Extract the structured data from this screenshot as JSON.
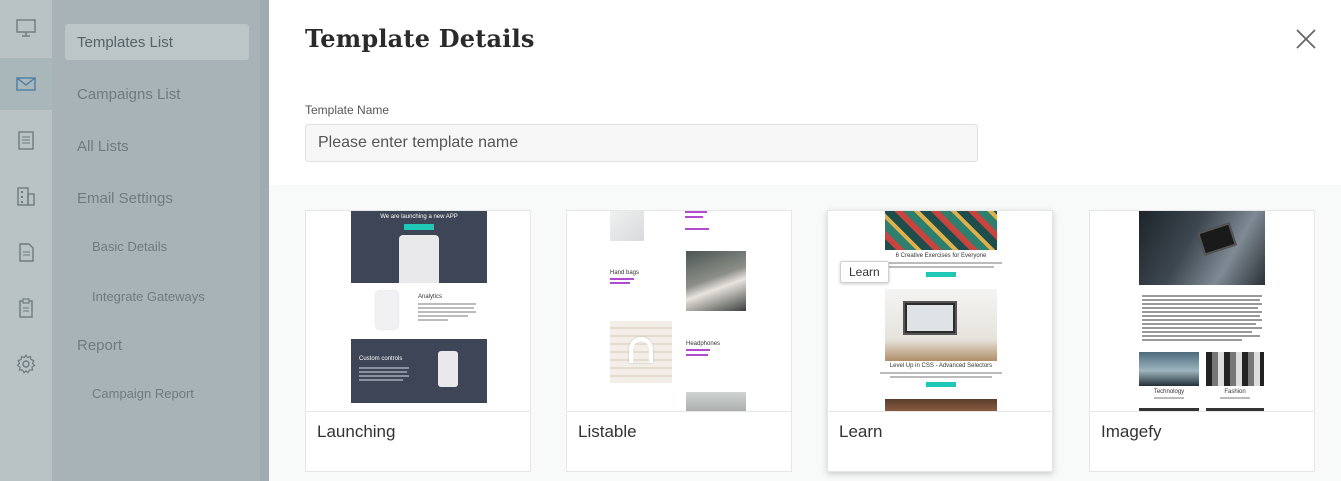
{
  "rail": {
    "icons": [
      "monitor-icon",
      "envelope-icon",
      "document-icon",
      "building-icon",
      "file-icon",
      "clipboard-icon",
      "gear-icon"
    ],
    "active_index": 1
  },
  "sidebar": {
    "items": [
      {
        "label": "Templates List",
        "active": true
      },
      {
        "label": "Campaigns List"
      },
      {
        "label": "All Lists"
      },
      {
        "label": "Email Settings"
      }
    ],
    "email_settings_sub": [
      "Basic Details",
      "Integrate Gateways"
    ],
    "report": {
      "label": "Report",
      "sub": [
        "Campaign Report"
      ]
    }
  },
  "panel": {
    "title": "Template Details",
    "field_label": "Template Name",
    "field_placeholder": "Please enter template name",
    "field_value": ""
  },
  "templates": [
    {
      "name": "Launching",
      "preview": {
        "headline": "We are launching a new APP",
        "section_1": "Analytics",
        "section_2": "Custom controls"
      }
    },
    {
      "name": "Listable",
      "preview": {
        "item_1": "Hand bags",
        "item_2": "Headphones"
      }
    },
    {
      "name": "Learn",
      "tooltip": "Learn",
      "preview": {
        "heading_1": "6 Creative Exercises for Everyone",
        "heading_2": "Level Up in CSS - Advanced Selectors"
      }
    },
    {
      "name": "Imagefy",
      "preview": {
        "caption_1": "Technology",
        "caption_2": "Fashion"
      }
    }
  ],
  "colors": {
    "rail_bg": "#b9c3c6",
    "menu_bg": "#a7b3b7",
    "accent_teal": "#1fc7b6",
    "navy": "#3d4556"
  }
}
